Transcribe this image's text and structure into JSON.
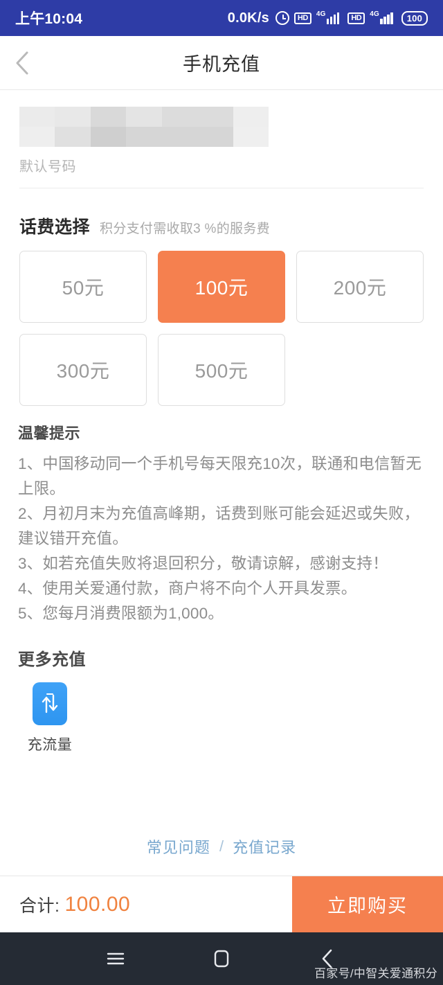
{
  "statusbar": {
    "time": "上午10:04",
    "network_speed": "0.0K/s",
    "alarm_icon": "alarm-clock-icon",
    "hd1": "HD",
    "hd2": "HD",
    "signal1_label": "4G",
    "signal2_label": "4G",
    "battery": "100",
    "background_color": "#2E3CA6"
  },
  "header": {
    "back_icon": "back-chevron-icon",
    "title": "手机充值"
  },
  "phone_section": {
    "number_label": "默认号码",
    "number_value_redacted": true
  },
  "amount_section": {
    "title": "话费选择",
    "subtitle": "积分支付需收取3 %的服务费",
    "selected_index": 1,
    "accent_color": "#F5804F",
    "options": [
      {
        "label": "50元",
        "value": 50,
        "selected": false
      },
      {
        "label": "100元",
        "value": 100,
        "selected": true
      },
      {
        "label": "200元",
        "value": 200,
        "selected": false
      },
      {
        "label": "300元",
        "value": 300,
        "selected": false
      },
      {
        "label": "500元",
        "value": 500,
        "selected": false
      }
    ]
  },
  "tips_section": {
    "title": "温馨提示",
    "items": [
      "1、中国移动同一个手机号每天限充10次，联通和电信暂无上限。",
      "2、月初月末为充值高峰期，话费到账可能会延迟或失败，建议错开充值。",
      "3、如若充值失败将退回积分，敬请谅解，感谢支持！",
      "4、使用关爱通付款，商户将不向个人开具发票。",
      "5、您每月消费限额为1,000。"
    ]
  },
  "more_section": {
    "title": "更多充值",
    "items": [
      {
        "icon": "data-flow-icon",
        "label": "充流量",
        "icon_color": "#3FA2F7"
      }
    ]
  },
  "links_section": {
    "faq": "常见问题",
    "separator": "/",
    "records": "充值记录",
    "link_color": "#78A7CE"
  },
  "bottom_bar": {
    "total_label": "合计:",
    "total_value": "100.00",
    "buy_button": "立即购买",
    "button_color": "#F5804F",
    "amount_color": "#F0823F"
  },
  "android_nav": {
    "menu_icon": "menu-icon",
    "home_icon": "home-icon",
    "back_icon": "back-icon",
    "watermark": "百家号/中智关爱通积分"
  }
}
